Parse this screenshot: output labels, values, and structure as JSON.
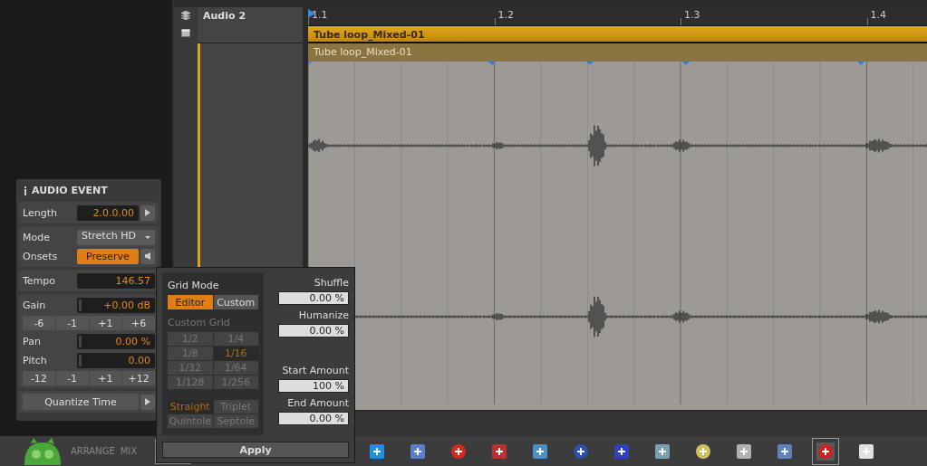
{
  "track": {
    "name": "Audio 2"
  },
  "ruler": {
    "labels": [
      "1.1",
      "1.2",
      "1.3",
      "1.4"
    ]
  },
  "clip": {
    "title": "Tube loop_Mixed-01",
    "event_title": "Tube loop_Mixed-01"
  },
  "inspector": {
    "title": "AUDIO EVENT",
    "length": {
      "label": "Length",
      "value": "2.0.0.00"
    },
    "mode": {
      "label": "Mode",
      "value": "Stretch HD"
    },
    "onsets": {
      "label": "Onsets",
      "value": "Preserve"
    },
    "tempo": {
      "label": "Tempo",
      "value": "146.57"
    },
    "gain": {
      "label": "Gain",
      "value": "+0.00 dB"
    },
    "gain_steps": [
      "-6",
      "-1",
      "+1",
      "+6"
    ],
    "pan": {
      "label": "Pan",
      "value": "0.00 %"
    },
    "pitch": {
      "label": "Pitch",
      "value": "0.00"
    },
    "pitch_steps": [
      "-12",
      "-1",
      "+1",
      "+12"
    ],
    "quantize": "Quantize Time"
  },
  "popup": {
    "grid_mode_label": "Grid Mode",
    "grid_modes": [
      {
        "label": "Editor",
        "selected": true
      },
      {
        "label": "Custom",
        "selected": false
      }
    ],
    "custom_grid": {
      "label": "Custom Grid",
      "disabled": true,
      "values": [
        {
          "label": "1/2",
          "selected": false
        },
        {
          "label": "1/4",
          "selected": false
        },
        {
          "label": "1/8",
          "selected": false
        },
        {
          "label": "1/16",
          "selected": true
        },
        {
          "label": "1/32",
          "selected": false
        },
        {
          "label": "1/64",
          "selected": false
        },
        {
          "label": "1/128",
          "selected": false
        },
        {
          "label": "1/256",
          "selected": false
        }
      ],
      "feels": [
        {
          "label": "Straight",
          "selected": true
        },
        {
          "label": "Triplet",
          "selected": false
        },
        {
          "label": "Quintole",
          "selected": false
        },
        {
          "label": "Septole",
          "selected": false
        }
      ]
    },
    "fields": [
      {
        "label": "Shuffle",
        "value": "0.00 %"
      },
      {
        "label": "Humanize",
        "value": "0.00 %"
      },
      {
        "label": "Start Amount",
        "value": "100 %"
      },
      {
        "label": "End Amount",
        "value": "0.00 %"
      }
    ],
    "apply": "Apply"
  },
  "bottom_labels": [
    "ARRANGE",
    "MIX"
  ]
}
